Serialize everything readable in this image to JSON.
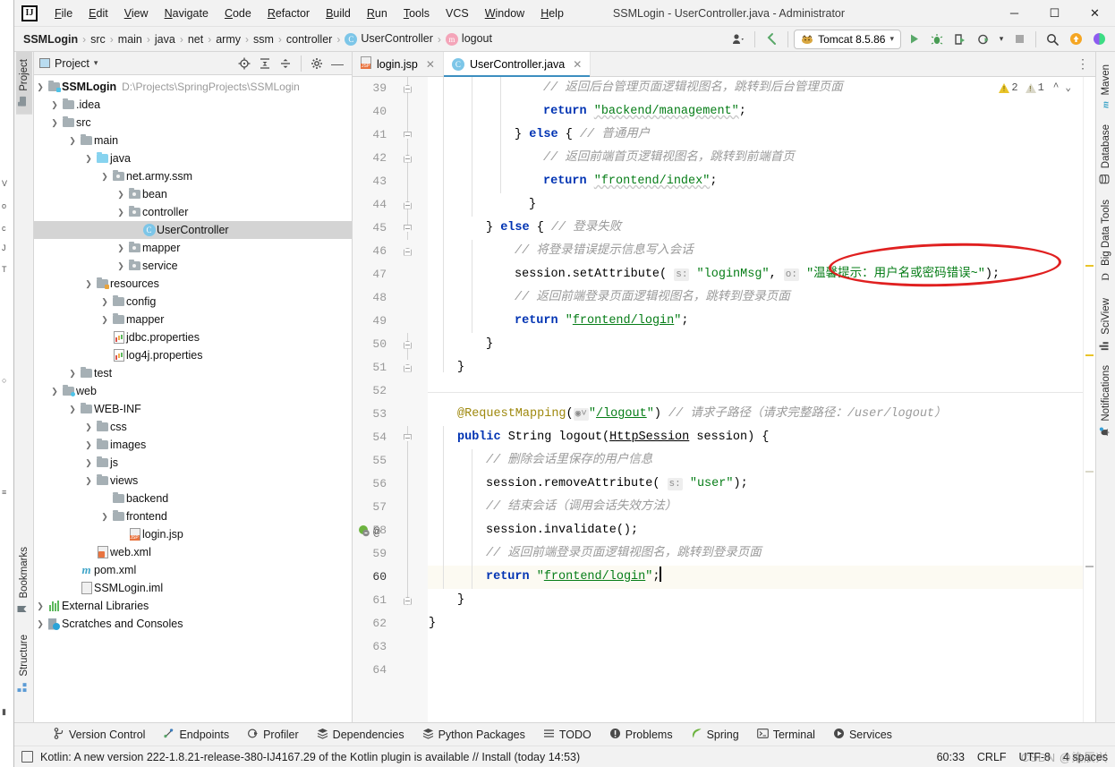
{
  "window": {
    "title": "SSMLogin - UserController.java - Administrator",
    "logo": "IJ",
    "minimize": "─",
    "maximize": "☐",
    "close": "✕"
  },
  "menubar": {
    "items": [
      "File",
      "Edit",
      "View",
      "Navigate",
      "Code",
      "Refactor",
      "Build",
      "Run",
      "Tools",
      "VCS",
      "Window",
      "Help"
    ]
  },
  "navbar": {
    "crumbs": [
      "SSMLogin",
      "src",
      "main",
      "java",
      "net",
      "army",
      "ssm",
      "controller",
      "UserController",
      "logout"
    ],
    "class_badge": "C",
    "method_badge": "m",
    "separator": "›",
    "run_config": "Tomcat 8.5.86",
    "run_config_icon": "tomcat-icon",
    "buttons": {
      "user_icon": "👤",
      "back_arrow": "↖",
      "run": "▶",
      "debug": "debug-icon",
      "run_with_coverage": "coverage-icon",
      "profiler": "profiler-icon",
      "stop": "■",
      "search": "🔍",
      "updates": "↑",
      "ai_assistant": "◐"
    }
  },
  "left_strip": {
    "tabs": [
      {
        "label": "Project",
        "icon": "project-icon",
        "active": true
      },
      {
        "label": "Bookmarks",
        "icon": "bookmark-icon",
        "active": false
      },
      {
        "label": "Structure",
        "icon": "structure-icon",
        "active": false
      }
    ]
  },
  "right_strip": {
    "tabs": [
      {
        "label": "Maven",
        "icon": "maven-icon"
      },
      {
        "label": "Database",
        "icon": "database-icon"
      },
      {
        "label": "Big Data Tools",
        "icon": "bigdata-icon"
      },
      {
        "label": "SciView",
        "icon": "sciview-icon"
      },
      {
        "label": "Notifications",
        "icon": "notifications-icon"
      }
    ]
  },
  "project_panel": {
    "title": "Project",
    "dropdown": "▾",
    "actions": [
      "locate-icon",
      "expand-all-icon",
      "collapse-all-icon",
      "settings-gear-icon",
      "hide-icon"
    ],
    "root": {
      "name": "SSMLogin",
      "path": "D:\\Projects\\SpringProjects\\SSMLogin"
    },
    "tree": [
      {
        "depth": 0,
        "arrow": "down",
        "icon": "project-root",
        "label": "SSMLogin",
        "bold": true,
        "path": "D:\\Projects\\SpringProjects\\SSMLogin"
      },
      {
        "depth": 1,
        "arrow": "right",
        "icon": "folder",
        "label": ".idea"
      },
      {
        "depth": 1,
        "arrow": "down",
        "icon": "folder",
        "label": "src"
      },
      {
        "depth": 2,
        "arrow": "down",
        "icon": "folder",
        "label": "main"
      },
      {
        "depth": 3,
        "arrow": "down",
        "icon": "folder-source",
        "label": "java"
      },
      {
        "depth": 4,
        "arrow": "down",
        "icon": "folder-package",
        "label": "net.army.ssm"
      },
      {
        "depth": 5,
        "arrow": "right",
        "icon": "folder-package",
        "label": "bean"
      },
      {
        "depth": 5,
        "arrow": "down",
        "icon": "folder-package",
        "label": "controller"
      },
      {
        "depth": 6,
        "arrow": "none",
        "icon": "java-class",
        "label": "UserController",
        "selected": true
      },
      {
        "depth": 5,
        "arrow": "right",
        "icon": "folder-package",
        "label": "mapper"
      },
      {
        "depth": 5,
        "arrow": "right",
        "icon": "folder-package",
        "label": "service"
      },
      {
        "depth": 3,
        "arrow": "down",
        "icon": "folder-resources",
        "label": "resources"
      },
      {
        "depth": 4,
        "arrow": "right",
        "icon": "folder",
        "label": "config"
      },
      {
        "depth": 4,
        "arrow": "right",
        "icon": "folder",
        "label": "mapper"
      },
      {
        "depth": 4,
        "arrow": "none",
        "icon": "properties-file",
        "label": "jdbc.properties"
      },
      {
        "depth": 4,
        "arrow": "none",
        "icon": "properties-file",
        "label": "log4j.properties"
      },
      {
        "depth": 2,
        "arrow": "right",
        "icon": "folder",
        "label": "test"
      },
      {
        "depth": 1,
        "arrow": "down",
        "icon": "folder-web",
        "label": "web"
      },
      {
        "depth": 2,
        "arrow": "down",
        "icon": "folder",
        "label": "WEB-INF"
      },
      {
        "depth": 3,
        "arrow": "right",
        "icon": "folder",
        "label": "css"
      },
      {
        "depth": 3,
        "arrow": "right",
        "icon": "folder",
        "label": "images"
      },
      {
        "depth": 3,
        "arrow": "right",
        "icon": "folder",
        "label": "js"
      },
      {
        "depth": 3,
        "arrow": "down",
        "icon": "folder",
        "label": "views"
      },
      {
        "depth": 4,
        "arrow": "none",
        "icon": "folder",
        "label": "backend"
      },
      {
        "depth": 4,
        "arrow": "down",
        "icon": "folder",
        "label": "frontend"
      },
      {
        "depth": 5,
        "arrow": "none",
        "icon": "jsp-file",
        "label": "login.jsp"
      },
      {
        "depth": 3,
        "arrow": "none",
        "icon": "xml-web-file",
        "label": "web.xml"
      },
      {
        "depth": 2,
        "arrow": "none",
        "icon": "maven-pom",
        "label": "pom.xml"
      },
      {
        "depth": 2,
        "arrow": "none",
        "icon": "iml-file",
        "label": "SSMLogin.iml"
      },
      {
        "depth": 0,
        "arrow": "right",
        "icon": "external-libraries",
        "label": "External Libraries"
      },
      {
        "depth": 0,
        "arrow": "right",
        "icon": "scratches",
        "label": "Scratches and Consoles"
      }
    ]
  },
  "editor": {
    "tabs": [
      {
        "label": "login.jsp",
        "icon": "jsp-file-icon",
        "active": false,
        "close": "✕"
      },
      {
        "label": "UserController.java",
        "icon": "java-class-icon",
        "active": true,
        "close": "✕"
      }
    ],
    "inspections": {
      "warning_count": "2",
      "weak_warning_count": "1",
      "up": "⌃",
      "down": "⌄"
    },
    "first_line_number": 39,
    "highlighted_line": 60,
    "lines": [
      {
        "n": 39,
        "indent": 8,
        "html": "<span class=\"c\">// 返回后台管理页面逻辑视图名，跳转到后台管理页面</span>"
      },
      {
        "n": 40,
        "indent": 8,
        "html": "<span class=\"k\">return</span> <span class=\"s sq-underline\">\"backend/management\"</span>;"
      },
      {
        "n": 41,
        "indent": 6,
        "html": "} <span class=\"k\">else</span> { <span class=\"c\">// 普通用户</span>"
      },
      {
        "n": 42,
        "indent": 8,
        "html": "<span class=\"c\">// 返回前端首页逻辑视图名，跳转到前端首页</span>"
      },
      {
        "n": 43,
        "indent": 8,
        "html": "<span class=\"k\">return</span> <span class=\"s sq-underline\">\"frontend/index\"</span>;"
      },
      {
        "n": 44,
        "indent": 6,
        "html": "}"
      },
      {
        "n": 45,
        "indent": 4,
        "html": "} <span class=\"k\">else</span> { <span class=\"c\">// 登录失败</span>"
      },
      {
        "n": 46,
        "indent": 6,
        "html": "<span class=\"c\">// 将登录错误提示信息写入会话</span>"
      },
      {
        "n": 47,
        "indent": 6,
        "html": "session.setAttribute( <span class=\"hint\">s:</span> <span class=\"s\">\"loginMsg\"</span>, <span class=\"hint\">o:</span> <span class=\"s\">\"温馨提示：用户名或密码错误~\"</span>);"
      },
      {
        "n": 48,
        "indent": 6,
        "html": "<span class=\"c\">// 返回前端登录页面逻辑视图名，跳转到登录页面</span>"
      },
      {
        "n": 49,
        "indent": 6,
        "html": "<span class=\"k\">return</span> <span class=\"s\">\"<u>frontend/login</u>\"</span>;"
      },
      {
        "n": 50,
        "indent": 4,
        "html": "}"
      },
      {
        "n": 51,
        "indent": 2,
        "html": "}"
      },
      {
        "n": 52,
        "indent": 0,
        "html": ""
      },
      {
        "n": 53,
        "indent": 2,
        "html": "<span class=\"a\">@RequestMapping</span>(<span class=\"hint\">⊙˅</span><span class=\"s\">\"<u>/logout</u>\"</span>) <span class=\"c\">// 请求子路径（请求完整路径：/user/logout）</span>"
      },
      {
        "n": 54,
        "indent": 2,
        "html": "<span class=\"k\">public</span> String logout(<span class=\"uline\">HttpSession</span> session) {"
      },
      {
        "n": 55,
        "indent": 4,
        "html": "<span class=\"c\">// 删除会话里保存的用户信息</span>"
      },
      {
        "n": 56,
        "indent": 4,
        "html": "session.removeAttribute( <span class=\"hint\">s:</span> <span class=\"s\">\"user\"</span>);"
      },
      {
        "n": 57,
        "indent": 4,
        "html": "<span class=\"c\">// 结束会话（调用会话失效方法）</span>"
      },
      {
        "n": 58,
        "indent": 4,
        "html": "session.invalidate();"
      },
      {
        "n": 59,
        "indent": 4,
        "html": "<span class=\"c\">// 返回前端登录页面逻辑视图名，跳转到登录页面</span>"
      },
      {
        "n": 60,
        "indent": 4,
        "html": "<span class=\"k\">return</span> <span class=\"s\">\"<u>frontend/login</u>\"</span>;<span class=\"caret\"></span>"
      },
      {
        "n": 61,
        "indent": 2,
        "html": "}"
      },
      {
        "n": 62,
        "indent": 0,
        "html": "}"
      },
      {
        "n": 63,
        "indent": 0,
        "html": ""
      },
      {
        "n": 64,
        "indent": 0,
        "html": ""
      }
    ],
    "annotation": {
      "shape": "ellipse",
      "color": "#e02020",
      "target": "温馨提示：用户名或密码错误~"
    }
  },
  "tool_window_bar": {
    "items": [
      {
        "label": "Version Control",
        "icon": "branch-icon"
      },
      {
        "label": "Endpoints",
        "icon": "endpoints-icon"
      },
      {
        "label": "Profiler",
        "icon": "profiler-icon"
      },
      {
        "label": "Dependencies",
        "icon": "dependencies-icon"
      },
      {
        "label": "Python Packages",
        "icon": "python-packages-icon"
      },
      {
        "label": "TODO",
        "icon": "todo-icon"
      },
      {
        "label": "Problems",
        "icon": "problems-icon"
      },
      {
        "label": "Spring",
        "icon": "spring-leaf-icon"
      },
      {
        "label": "Terminal",
        "icon": "terminal-icon"
      },
      {
        "label": "Services",
        "icon": "services-icon"
      }
    ]
  },
  "status_bar": {
    "message": "Kotlin: A new version 222-1.8.21-release-380-IJ4167.29 of the Kotlin plugin is available // Install (today 14:53)",
    "message_icon": "event-log-icon",
    "caret_position": "60:33",
    "line_separator": "CRLF",
    "encoding": "UTF-8",
    "indent": "4 spaces",
    "watermark": "CSDN @染辰兴"
  },
  "colors": {
    "accent": "#3c8ec0",
    "keyword": "#0033b3",
    "string": "#067d17",
    "comment": "#9a9a9a",
    "annotation": "#9e880d",
    "annotation_ellipse": "#e02020",
    "selection": "#d4d4d4",
    "highlight_line": "#fcfaf2"
  }
}
